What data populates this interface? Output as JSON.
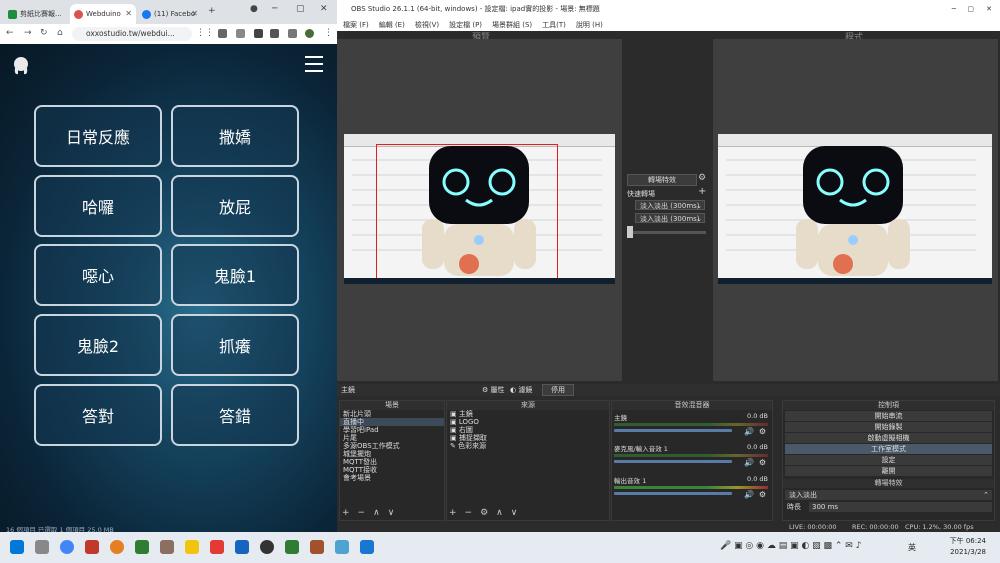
{
  "chrome": {
    "tabs": [
      {
        "label": "剪紙比賽報...",
        "color": "#1e8e3e"
      },
      {
        "label": "Webduino",
        "color": "#d9534f"
      },
      {
        "label": "(11) Facebo",
        "color": "#1877f2"
      }
    ],
    "url": "oxxostudio.tw/webdui...",
    "status": "16 個項目    已選取 1 個項目 25.0 MB",
    "buttons": [
      "日常反應",
      "撒嬌",
      "哈囉",
      "放屁",
      "噁心",
      "鬼臉1",
      "鬼臉2",
      "抓癢",
      "答對",
      "答錯"
    ]
  },
  "obs": {
    "title": "OBS Studio 26.1.1 (64-bit, windows) - 設定檔: ipad實的投影 - 場景: 無標題",
    "menu": [
      "檔案 (F)",
      "編輯 (E)",
      "檢視(V)",
      "設定檔 (P)",
      "場景群組 (S)",
      "工具(T)",
      "說明 (H)"
    ],
    "preview_label": "預覽",
    "program_label": "程式",
    "transition_button": "轉場特效",
    "quick_transitions": "快速轉場",
    "quick_items": [
      "淡入淡出 (300ms)",
      "淡入淡出 (300ms)"
    ],
    "status_bar": {
      "scene_name": "主鏡",
      "properties": "屬性",
      "filters": "濾鏡",
      "stop": "停用"
    },
    "scenes": {
      "title": "場景",
      "items": [
        "新北片頭",
        "直播中",
        "學習吧iPad",
        "片尾",
        "多源OBS工作模式",
        "城堡擺炮",
        "MQTT發出",
        "MQTT接收",
        "會考場景"
      ],
      "selected": 1
    },
    "sources": {
      "title": "來源",
      "items": [
        "主鏡",
        "LOGO",
        "右圖",
        "捕捉擷取",
        "色彩來源"
      ]
    },
    "mixer": {
      "title": "音效混音器",
      "channels": [
        {
          "name": "主鏡",
          "db": "0.0 dB"
        },
        {
          "name": "麥克風/輸入音效 1",
          "db": "0.0 dB"
        },
        {
          "name": "輸出音效 1",
          "db": "0.0 dB"
        }
      ]
    },
    "controls": {
      "title": "控制項",
      "items": [
        "開始串流",
        "開始錄製",
        "啟動虛擬相機",
        "工作室模式",
        "設定",
        "離開"
      ],
      "selected": 3
    },
    "transitions": {
      "title": "轉場特效",
      "current": "淡入淡出",
      "duration_label": "時長",
      "duration": "300 ms"
    },
    "bottom": {
      "live": "LIVE: 00:00:00",
      "rec": "REC: 00:00:00",
      "cpu": "CPU: 1.2%, 30.00 fps"
    }
  },
  "taskbar": {
    "ime": "英",
    "time": "下午 06:24",
    "date": "2021/3/28"
  }
}
